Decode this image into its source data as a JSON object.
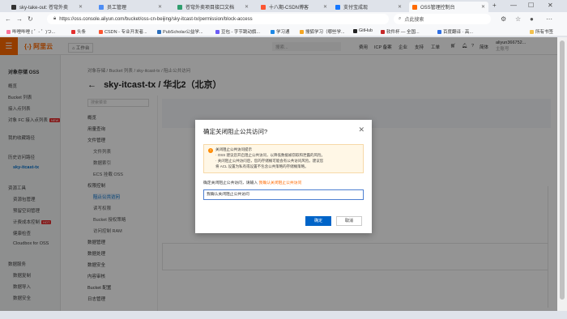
{
  "browser": {
    "tabs": [
      {
        "title": "sky-take-out: 苍穹外卖"
      },
      {
        "title": "员工管理"
      },
      {
        "title": "苍穹外卖项目接口文档"
      },
      {
        "title": "十八期-CSDN博客"
      },
      {
        "title": "支付宝成现"
      },
      {
        "title": "OSS管理控制台"
      }
    ],
    "url": "https://oss.console.aliyun.com/bucket/oss-cn-beijing/sky-itcast-tx/permission/block-access",
    "search_placeholder": "点此搜索",
    "bookmarks": [
      "哔哩哔哩 ( ゜- ゜)つ...",
      "头条",
      "CSDN - 专业开发者...",
      "PubScholar公益学...",
      "豆包 - 字节跳动旗...",
      "学习通",
      "搜狐学习（哪些学...",
      "GitHub",
      "软件杯 — 全国...",
      "百度翻译 · 高...",
      "所有书签"
    ]
  },
  "console": {
    "logo": "阿里云",
    "workbench": "工作台",
    "search_placeholder": "搜索...",
    "header_links": [
      "费用",
      "ICP 备案",
      "企业",
      "支持",
      "工单"
    ],
    "lang": "简体",
    "user_name": "aliyun366752...",
    "user_sub": "主账号"
  },
  "left_nav": {
    "title": "对象存储 OSS",
    "items": [
      "概览",
      "Bucket 列表",
      "接入点列表",
      "对象 FC 接入点列表"
    ],
    "badge": "NEW",
    "recent_title": "我的收藏路径",
    "recent_group": "历史访问路径",
    "recent_bucket": "sky-itcast-tx",
    "resources_title": "资源工具",
    "resources": [
      "资源包管理",
      "预留空间管理",
      "计费成本控制",
      "健康检查",
      "Cloudbox for OSS"
    ],
    "hot_badge": "HOT",
    "data_title": "数据服务",
    "data_items": [
      "数据复制",
      "数据导入",
      "数据安全"
    ]
  },
  "page": {
    "breadcrumb": "对象存储 / Bucket 列表 / sky-itcast-tx / 阻止公共访问",
    "title": "sky-itcast-tx / 华北2（北京）"
  },
  "bucket_nav": {
    "search_placeholder": "搜索菜单",
    "groups": [
      "概览",
      "用量查询",
      "文件管理",
      "权限控制",
      "数据管理",
      "数据处理",
      "数据安全",
      "内容审核",
      "Bucket 配置",
      "日志管理"
    ],
    "perm_items": [
      "文件列表",
      "数据索引",
      "ECS 挂载 OSS",
      "权限控制",
      "阻止公共访问",
      "读写权限",
      "Bucket 授权策略",
      "访问控制 RAM"
    ]
  },
  "modal": {
    "title": "确定关闭阻止公共访问?",
    "warn_title": "关闭阻止公共访问提示",
    "warn_lines": [
      "· OSS 建议您开启阻止公共访问，以降低数据被窃取和泄露的风险。",
      "· 关闭阻止公共访问后，您的存储桶可能会有公共访问风险。建议您",
      "将 ACL 设置为私有或设置不包含公共策略的存储桶策略。"
    ],
    "confirm_prefix": "确定关闭阻止公共访问，请输入",
    "confirm_phrase": "我确认关闭阻止公共访问",
    "input_value": "我确认关闭阻止公共访问",
    "ok_label": "确定",
    "cancel_label": "取消"
  },
  "colors": {
    "brand": "#ff6a00",
    "primary": "#0064c8",
    "warn_bg": "#fff7e6"
  }
}
